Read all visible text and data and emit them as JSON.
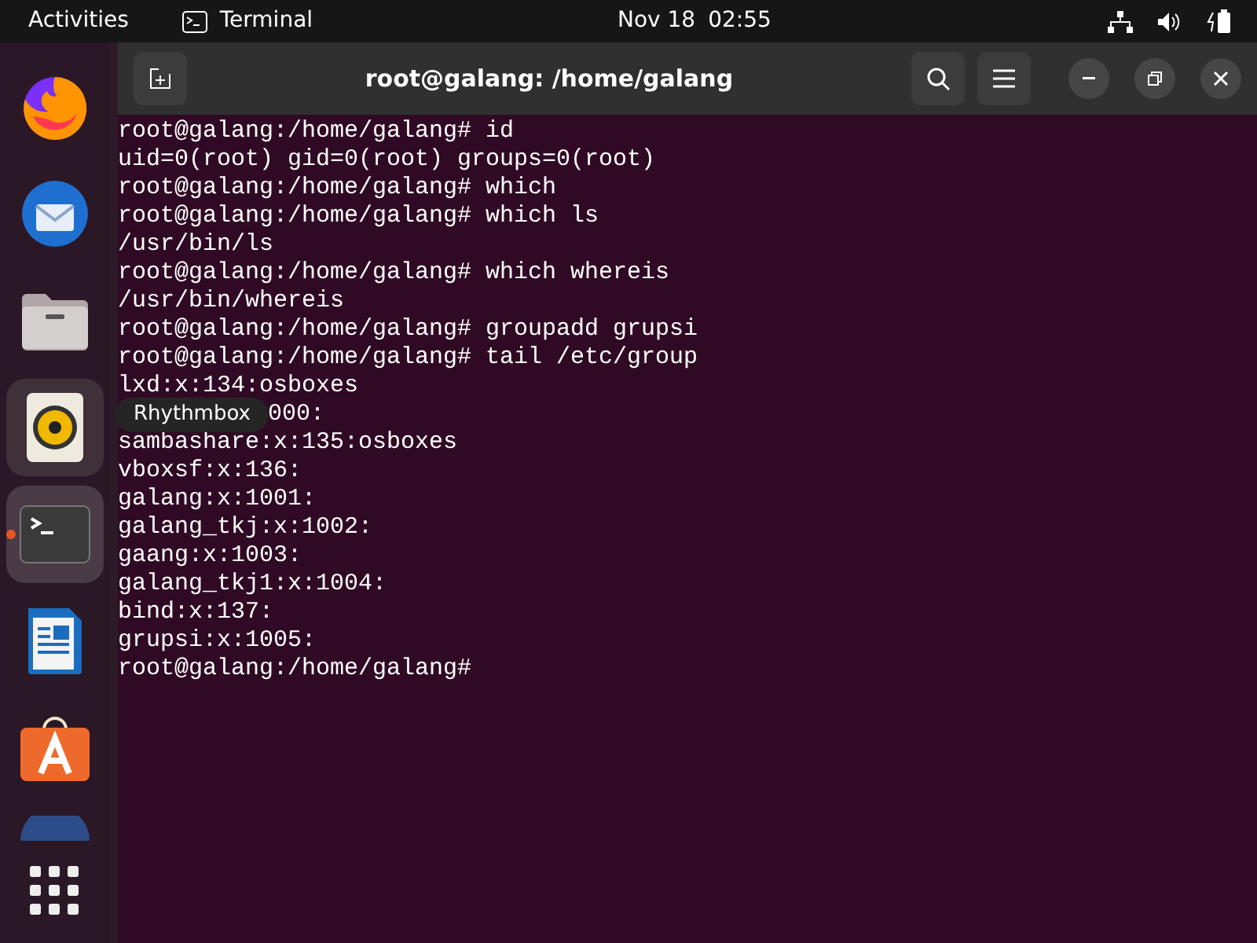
{
  "top_bar": {
    "activities": "Activities",
    "app_name": "Terminal",
    "date": "Nov 18",
    "time": "02:55"
  },
  "dock": {
    "items": [
      {
        "kind": "firefox",
        "running": false,
        "hovered": false
      },
      {
        "kind": "thunderbird",
        "running": false,
        "hovered": false
      },
      {
        "kind": "files",
        "running": false,
        "hovered": false
      },
      {
        "kind": "rhythmbox",
        "running": false,
        "hovered": true
      },
      {
        "kind": "terminal",
        "running": true,
        "hovered": false
      },
      {
        "kind": "writer",
        "running": false,
        "hovered": false
      },
      {
        "kind": "software",
        "running": false,
        "hovered": false
      },
      {
        "kind": "globe",
        "running": false,
        "hovered": false
      }
    ],
    "tooltip": "Rhythmbox"
  },
  "window": {
    "title": "root@galang: /home/galang"
  },
  "terminal": {
    "lines": [
      {
        "kind": "line",
        "text": "root@galang:/home/galang# id"
      },
      {
        "kind": "line",
        "text": "uid=0(root) gid=0(root) groups=0(root)"
      },
      {
        "kind": "line",
        "text": "root@galang:/home/galang# which"
      },
      {
        "kind": "line",
        "text": "root@galang:/home/galang# which ls"
      },
      {
        "kind": "line",
        "text": "/usr/bin/ls"
      },
      {
        "kind": "line",
        "text": "root@galang:/home/galang# which whereis"
      },
      {
        "kind": "line",
        "text": "/usr/bin/whereis"
      },
      {
        "kind": "line",
        "text": "root@galang:/home/galang# groupadd grupsi"
      },
      {
        "kind": "line",
        "text": "root@galang:/home/galang# tail /etc/group"
      },
      {
        "kind": "line",
        "text": "lxd:x:134:osboxes"
      },
      {
        "kind": "behind-tooltip",
        "text": "000:"
      },
      {
        "kind": "line",
        "text": "sambashare:x:135:osboxes"
      },
      {
        "kind": "line",
        "text": "vboxsf:x:136:"
      },
      {
        "kind": "line",
        "text": "galang:x:1001:"
      },
      {
        "kind": "line",
        "text": "galang_tkj:x:1002:"
      },
      {
        "kind": "line",
        "text": "gaang:x:1003:"
      },
      {
        "kind": "line",
        "text": "galang_tkj1:x:1004:"
      },
      {
        "kind": "line",
        "text": "bind:x:137:"
      },
      {
        "kind": "line",
        "text": "grupsi:x:1005:"
      },
      {
        "kind": "line",
        "text": "root@galang:/home/galang#"
      }
    ]
  }
}
